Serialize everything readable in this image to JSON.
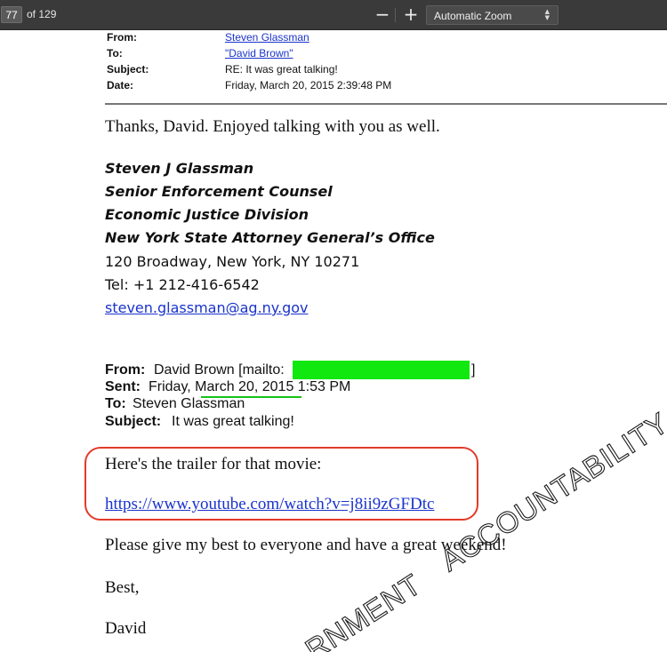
{
  "toolbar": {
    "page_current": "77",
    "page_total_label": "of 129",
    "zoom_out_icon": "minus-icon",
    "zoom_in_icon": "plus-icon",
    "zoom_out_glyph": "−",
    "zoom_in_glyph": "+",
    "zoom_value": "Automatic Zoom",
    "zoom_arrows_up": "▲",
    "zoom_arrows_down": "▼"
  },
  "reply_header": {
    "from_label": "From:",
    "from_value": "Steven Glassman",
    "to_label": "To:",
    "to_value": "\"David Brown\"",
    "subject_label": "Subject:",
    "subject_value": "RE: It was great talking!",
    "date_label": "Date:",
    "date_value": "Friday, March 20, 2015 2:39:48 PM"
  },
  "reply_body": "Thanks, David.  Enjoyed talking with you as well.",
  "signature": {
    "name": "Steven J Glassman",
    "title": "Senior Enforcement Counsel",
    "division": "Economic Justice Division",
    "office": "New York State Attorney General’s Office",
    "address": "120 Broadway, New York, NY 10271",
    "phone": "Tel:  +1 212-416-6542",
    "email": "steven.glassman@ag.ny.gov"
  },
  "quoted_header": {
    "from_label": "From:",
    "from_value": "David Brown [mailto:",
    "from_close": "]",
    "sent_label": "Sent:",
    "sent_value": "Friday, March 20, 2015 1:53 PM",
    "to_label": "To:",
    "to_value": "Steven Glassman",
    "subject_label": "Subject:",
    "subject_value": "It was great talking!"
  },
  "quoted_body": {
    "trailer_line": "Here's the trailer for that movie:",
    "trailer_url": "https://www.youtube.com/watch?v=j8ii9zGFDtc",
    "closing_line": "Please give my best to everyone and have a great weekend!",
    "sign_off": "Best,",
    "sender": "David"
  },
  "watermark": {
    "line1": "ACCOUNTABILITY",
    "line2": "RNMENT"
  },
  "colors": {
    "toolbar_bg": "#3a3a3a",
    "link": "#1a33cc",
    "redaction": "#11e80f",
    "highlight_border": "#e23a2a",
    "underline_mark": "#16c21a"
  }
}
